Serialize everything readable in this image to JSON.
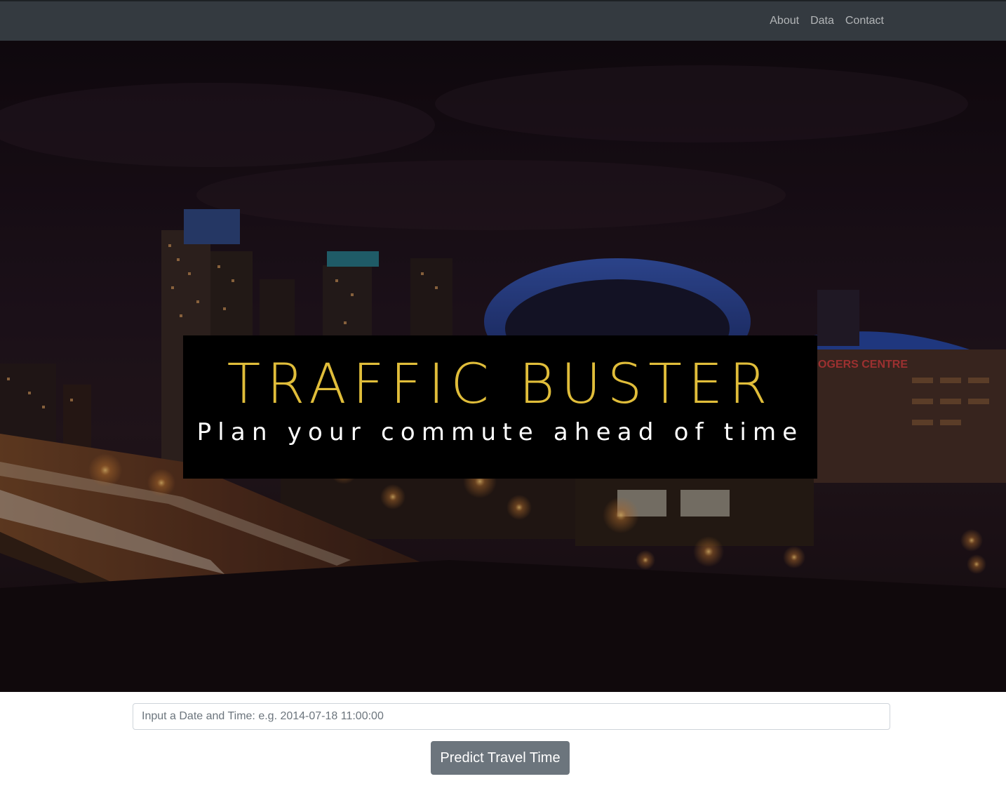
{
  "navbar": {
    "links": [
      "About",
      "Data",
      "Contact"
    ]
  },
  "hero": {
    "title": "TRAFFIC BUSTER",
    "subtitle": "Plan your commute ahead of time",
    "sign_text": "OGERS CENTRE",
    "colors": {
      "title": "#e0bd3a",
      "subtitle": "#ffffff",
      "box": "#000000"
    }
  },
  "form": {
    "input_placeholder": "Input a Date and Time: e.g. 2014-07-18 11:00:00",
    "input_value": "",
    "button_label": "Predict Travel Time"
  },
  "colors": {
    "navbar": "#343a40",
    "button": "#6c757d"
  }
}
